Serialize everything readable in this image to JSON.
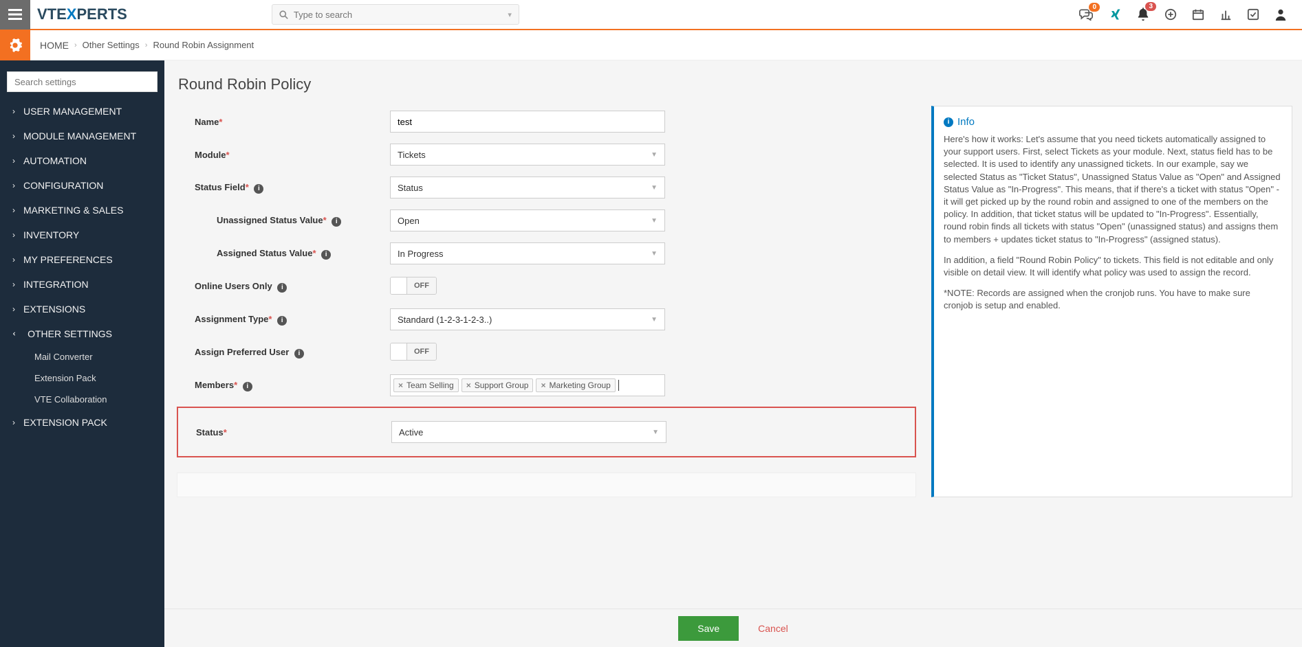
{
  "topbar": {
    "search_placeholder": "Type to search",
    "badges": {
      "chat": "0",
      "bell": "3"
    }
  },
  "logo": {
    "p1": "VTE",
    "p2": "X",
    "p3": "PERTS"
  },
  "breadcrumb": {
    "home": "HOME",
    "l2": "Other Settings",
    "l3": "Round Robin Assignment"
  },
  "sidebar": {
    "search_placeholder": "Search settings",
    "items": [
      {
        "label": "USER MANAGEMENT"
      },
      {
        "label": "MODULE MANAGEMENT"
      },
      {
        "label": "AUTOMATION"
      },
      {
        "label": "CONFIGURATION"
      },
      {
        "label": "MARKETING & SALES"
      },
      {
        "label": "INVENTORY"
      },
      {
        "label": "MY PREFERENCES"
      },
      {
        "label": "INTEGRATION"
      },
      {
        "label": "EXTENSIONS"
      },
      {
        "label": "OTHER SETTINGS",
        "expanded": true,
        "sub": [
          {
            "label": "Mail Converter"
          },
          {
            "label": "Extension Pack"
          },
          {
            "label": "VTE Collaboration"
          }
        ]
      },
      {
        "label": "EXTENSION PACK"
      }
    ]
  },
  "page": {
    "title": "Round Robin Policy"
  },
  "form": {
    "name": {
      "label": "Name",
      "value": "test"
    },
    "module": {
      "label": "Module",
      "value": "Tickets"
    },
    "status_field": {
      "label": "Status Field",
      "value": "Status"
    },
    "unassigned": {
      "label": "Unassigned Status Value",
      "value": "Open"
    },
    "assigned": {
      "label": "Assigned Status Value",
      "value": "In Progress"
    },
    "online_only": {
      "label": "Online Users Only",
      "value": "OFF"
    },
    "assign_type": {
      "label": "Assignment Type",
      "value": "Standard (1-2-3-1-2-3..)"
    },
    "preferred": {
      "label": "Assign Preferred User",
      "value": "OFF"
    },
    "members": {
      "label": "Members",
      "tags": [
        "Team Selling",
        "Support Group",
        "Marketing Group"
      ]
    },
    "status": {
      "label": "Status",
      "value": "Active"
    }
  },
  "info": {
    "title": "Info",
    "p1": "Here's how it works: Let's assume that you need tickets automatically assigned to your support users. First, select Tickets as your module. Next, status field has to be selected. It is used to identify any unassigned tickets. In our example, say we selected Status as \"Ticket Status\", Unassigned Status Value as \"Open\" and Assigned Status Value as \"In-Progress\". This means, that if there's a ticket with status \"Open\" - it will get picked up by the round robin and assigned to one of the members on the policy. In addition, that ticket status will be updated to \"In-Progress\". Essentially, round robin finds all tickets with status \"Open\" (unassigned status) and assigns them to members + updates ticket status to \"In-Progress\" (assigned status).",
    "p2": "In addition, a field \"Round Robin Policy\" to tickets. This field is not editable and only visible on detail view. It will identify what policy was used to assign the record.",
    "p3": "*NOTE: Records are assigned when the cronjob runs. You have to make sure cronjob is setup and enabled."
  },
  "footer": {
    "save": "Save",
    "cancel": "Cancel"
  }
}
